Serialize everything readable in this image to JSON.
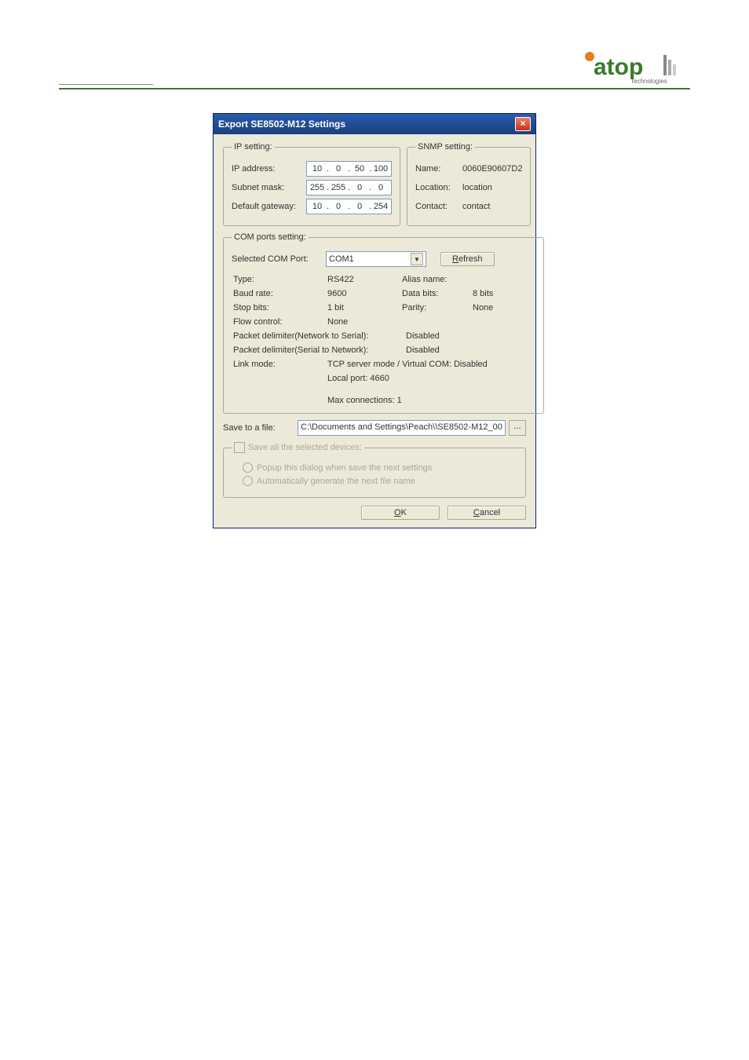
{
  "dialog": {
    "title": "Export SE8502-M12 Settings",
    "ip_setting": {
      "legend": "IP setting:",
      "ip_label": "IP address:",
      "ip": [
        "10",
        "0",
        "50",
        "100"
      ],
      "subnet_label": "Subnet mask:",
      "subnet": [
        "255",
        "255",
        "0",
        "0"
      ],
      "gateway_label": "Default gateway:",
      "gateway": [
        "10",
        "0",
        "0",
        "254"
      ]
    },
    "snmp_setting": {
      "legend": "SNMP setting:",
      "name_label": "Name:",
      "name_value": "0060E90607D2",
      "location_label": "Location:",
      "location_value": "location",
      "contact_label": "Contact:",
      "contact_value": "contact"
    },
    "com": {
      "legend": "COM ports setting:",
      "selected_label": "Selected COM Port:",
      "selected_value": "COM1",
      "refresh": "Refresh",
      "type_label": "Type:",
      "type_value": "RS422",
      "alias_label": "Alias name:",
      "alias_value": "",
      "baud_label": "Baud rate:",
      "baud_value": "9600",
      "databits_label": "Data bits:",
      "databits_value": "8 bits",
      "stopbits_label": "Stop bits:",
      "stopbits_value": "1 bit",
      "parity_label": "Parity:",
      "parity_value": "None",
      "flow_label": "Flow control:",
      "flow_value": "None",
      "pd_n2s_label": "Packet delimiter(Network to Serial):",
      "pd_n2s_value": "Disabled",
      "pd_s2n_label": "Packet delimiter(Serial to Network):",
      "pd_s2n_value": "Disabled",
      "linkmode_label": "Link mode:",
      "linkmode_value": "TCP server mode / Virtual COM: Disabled",
      "localport": "Local port: 4660",
      "maxconn": "Max connections: 1"
    },
    "save": {
      "label": "Save to a file:",
      "path": "C:\\Documents and Settings\\Peach\\\\SE8502-M12_00",
      "browse": "..."
    },
    "save_all": {
      "legend": "Save all the selected devices:",
      "opt1": "Popup this dialog when save the next settings",
      "opt2": "Automatically generate the next file name"
    },
    "buttons": {
      "ok_u": "O",
      "ok_rest": "K",
      "cancel_u": "C",
      "cancel_rest": "ancel"
    }
  }
}
